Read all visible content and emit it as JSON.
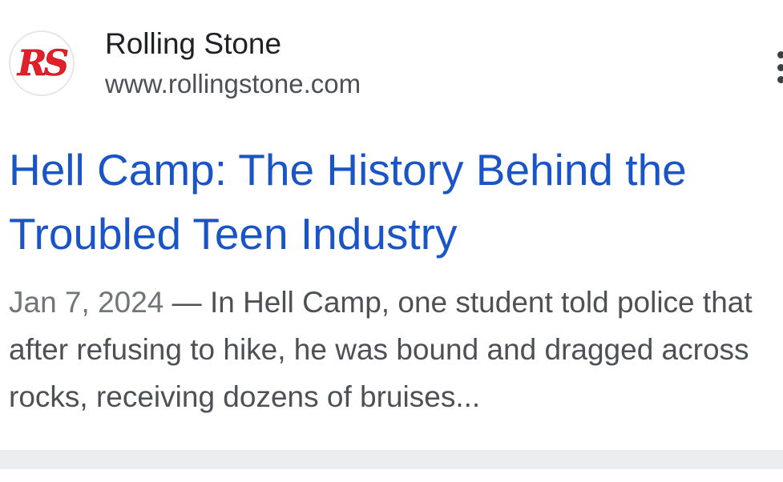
{
  "result": {
    "site_name": "Rolling Stone",
    "site_url": "www.rollingstone.com",
    "favicon": {
      "icon": "rolling-stone-logo",
      "text": "RS",
      "color": "#e2202a"
    },
    "title": "Hell Camp: The History Behind the Troubled Teen Industry",
    "date": "Jan 7, 2024",
    "separator": " — ",
    "snippet": "In Hell Camp, one student told police that after refusing to hike, he was bound and dragged across rocks, receiving dozens of bruises..."
  },
  "colors": {
    "title_link": "#1a55c7",
    "snippet_text": "#4d5156",
    "divider": "#ecedf0"
  }
}
